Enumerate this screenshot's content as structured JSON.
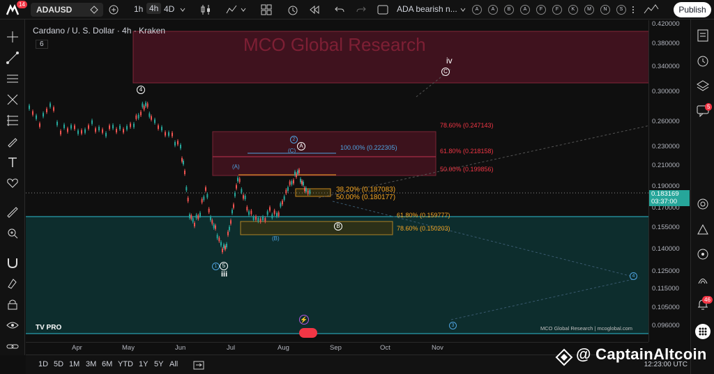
{
  "topbar": {
    "logo_badge": "14",
    "symbol": "ADAUSD",
    "intervals": [
      "1h",
      "4h",
      "4D"
    ],
    "active_interval": "4h",
    "layout_name": "ADA bearish n...",
    "circle_buttons": [
      "A",
      "A",
      "B",
      "A",
      "F",
      "F",
      "K",
      "M",
      "N",
      "S"
    ],
    "publish_label": "Publish"
  },
  "chart": {
    "title": "Cardano / U. S. Dollar · 4h · Kraken",
    "indicator_count": "6",
    "watermark": "MCO Global Research",
    "branding": "MCO Global Research | mcoglobal.com",
    "tv_logo": "TV PRO",
    "price_axis": [
      "0.420000",
      "0.380000",
      "0.340000",
      "0.300000",
      "0.260000",
      "0.230000",
      "0.210000",
      "0.190000",
      "0.170000",
      "0.155000",
      "0.140000",
      "0.125000",
      "0.115000",
      "0.105000",
      "0.096000"
    ],
    "current_price": "0.183169",
    "countdown": "03:37:00",
    "time_axis": [
      "Apr",
      "May",
      "Jun",
      "Jul",
      "Aug",
      "Sep",
      "Oct",
      "Nov"
    ],
    "fib_levels": [
      {
        "label": "78.60% (0.247143)",
        "color": "#f23645"
      },
      {
        "label": "100.00% (0.222305)",
        "color": "#4fa3e0"
      },
      {
        "label": "61.80% (0.218158)",
        "color": "#f23645"
      },
      {
        "label": "50.00% (0.199856)",
        "color": "#f23645"
      },
      {
        "label": "38.20% (0.187083)",
        "color": "#f5a623"
      },
      {
        "label": "50.00% (0.180177)",
        "color": "#f5a623"
      },
      {
        "label": "61.80% (0.159777)",
        "color": "#f5a623"
      },
      {
        "label": "78.60% (0.150203)",
        "color": "#f5a623"
      }
    ],
    "waves": {
      "w4": "4",
      "iv": "iv",
      "C_big": "C",
      "w2": "2",
      "A_circle": "A",
      "C_paren": "(C)",
      "A_paren": "(A)",
      "B_paren": "(B)",
      "B_circle": "B",
      "w1": "1",
      "w5": "5",
      "iii": "iii",
      "w4_blue": "4",
      "w3_blue": "3"
    }
  },
  "bottombar": {
    "ranges": [
      "1D",
      "5D",
      "1M",
      "3M",
      "6M",
      "YTD",
      "1Y",
      "5Y",
      "All"
    ],
    "utc_time": "12:23:00 UTC"
  },
  "overlay": {
    "brand_text": "@ CaptainAltcoin"
  },
  "right_badges": {
    "alerts": "5",
    "notifications": "46"
  },
  "colors": {
    "up": "#26a69a",
    "down": "#ef5350",
    "zone_red": "#7a1a2e",
    "zone_teal": "#0d3b3b",
    "zone_orange": "#f5a623",
    "accent_blue": "#4fa3e0"
  }
}
